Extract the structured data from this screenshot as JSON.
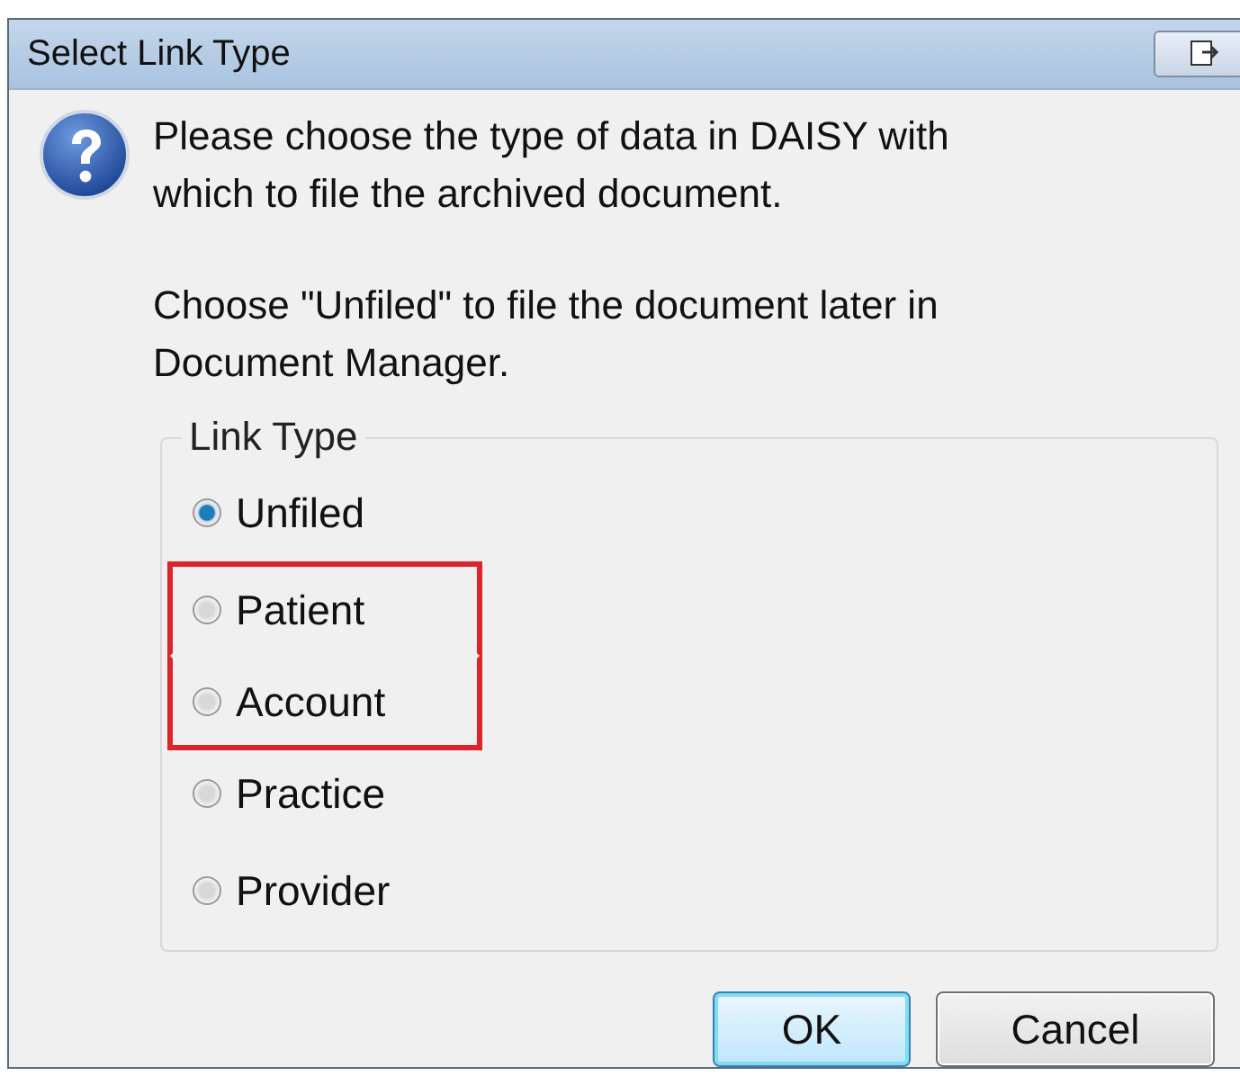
{
  "window": {
    "title": "Select Link Type"
  },
  "message": [
    "Please choose the type of data in DAISY with which to file the archived document.",
    "Choose \"Unfiled\" to file the document later in Document Manager."
  ],
  "group": {
    "label": "Link Type",
    "options": [
      {
        "label": "Unfiled",
        "selected": true,
        "highlighted": false
      },
      {
        "label": "Patient",
        "selected": false,
        "highlighted": true
      },
      {
        "label": "Account",
        "selected": false,
        "highlighted": true
      },
      {
        "label": "Practice",
        "selected": false,
        "highlighted": false
      },
      {
        "label": "Provider",
        "selected": false,
        "highlighted": false
      }
    ]
  },
  "buttons": [
    {
      "label": "OK",
      "default": true
    },
    {
      "label": "Cancel",
      "default": false
    }
  ]
}
